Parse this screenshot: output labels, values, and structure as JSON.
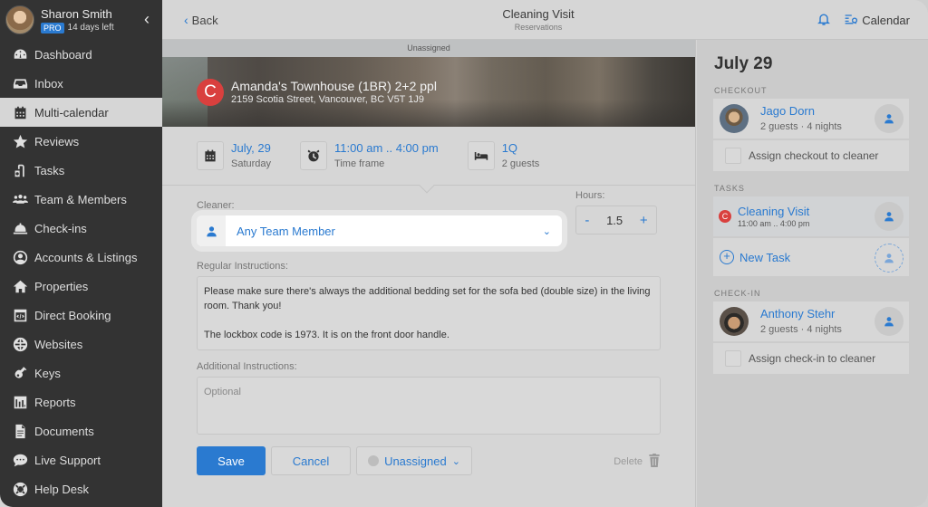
{
  "user": {
    "name": "Sharon Smith",
    "plan_badge": "PRO",
    "trial_text": "14 days left"
  },
  "sidebar": {
    "items": [
      {
        "label": "Dashboard",
        "icon": "dashboard-icon",
        "active": false
      },
      {
        "label": "Inbox",
        "icon": "inbox-icon",
        "active": false
      },
      {
        "label": "Multi-calendar",
        "icon": "calendar-icon",
        "active": true
      },
      {
        "label": "Reviews",
        "icon": "star-icon",
        "active": false
      },
      {
        "label": "Tasks",
        "icon": "vacuum-icon",
        "active": false
      },
      {
        "label": "Team & Members",
        "icon": "team-icon",
        "active": false
      },
      {
        "label": "Check-ins",
        "icon": "bell-service-icon",
        "active": false
      },
      {
        "label": "Accounts & Listings",
        "icon": "user-circle-icon",
        "active": false
      },
      {
        "label": "Properties",
        "icon": "home-icon",
        "active": false
      },
      {
        "label": "Direct Booking",
        "icon": "code-window-icon",
        "active": false
      },
      {
        "label": "Websites",
        "icon": "globe-icon",
        "active": false
      },
      {
        "label": "Keys",
        "icon": "guitar-icon",
        "active": false
      },
      {
        "label": "Reports",
        "icon": "bar-chart-icon",
        "active": false
      },
      {
        "label": "Documents",
        "icon": "document-icon",
        "active": false
      },
      {
        "label": "Live Support",
        "icon": "chat-icon",
        "active": false
      },
      {
        "label": "Help Desk",
        "icon": "lifebuoy-icon",
        "active": false
      }
    ]
  },
  "header": {
    "back_label": "Back",
    "title": "Cleaning Visit",
    "subtitle": "Reservations",
    "calendar_label": "Calendar"
  },
  "task": {
    "status_strip": "Unassigned",
    "property_initial": "C",
    "property_name": "Amanda's Townhouse (1BR) 2+2 ppl",
    "property_address": "2159 Scotia Street, Vancouver, BC V5T 1J9",
    "info": {
      "date_main": "July, 29",
      "date_sub": "Saturday",
      "time_main": "11:00 am .. 4:00 pm",
      "time_sub": "Time frame",
      "bed_main": "1Q",
      "bed_sub": "2 guests"
    },
    "form": {
      "cleaner_label": "Cleaner:",
      "cleaner_value": "Any Team Member",
      "hours_label": "Hours:",
      "hours_value": "1.5",
      "minus": "-",
      "plus": "+",
      "regular_label": "Regular Instructions:",
      "regular_p1": "Please make sure there's always the additional bedding set for the sofa bed (double size) in the living room. Thank you!",
      "regular_p2": "The lockbox code is 1973. It is on the front door handle.",
      "additional_label": "Additional Instructions:",
      "additional_placeholder": "Optional"
    },
    "actions": {
      "save": "Save",
      "cancel": "Cancel",
      "status": "Unassigned",
      "delete": "Delete"
    }
  },
  "day_panel": {
    "title": "July 29",
    "checkout_label": "CHECKOUT",
    "checkout": {
      "name": "Jago Dorn",
      "details": "2 guests · 4 nights",
      "assign_label": "Assign checkout to cleaner"
    },
    "tasks_label": "TASKS",
    "task_item": {
      "initial": "C",
      "title": "Cleaning Visit",
      "time": "11:00 am .. 4:00 pm"
    },
    "new_task_label": "New Task",
    "checkin_label": "CHECK-IN",
    "checkin": {
      "name": "Anthony Stehr",
      "details": "2 guests · 4 nights",
      "assign_label": "Assign check-in to cleaner"
    }
  },
  "colors": {
    "accent": "#2a7ad0",
    "sidebar_bg": "#333333",
    "badge_red": "#d9403e"
  }
}
